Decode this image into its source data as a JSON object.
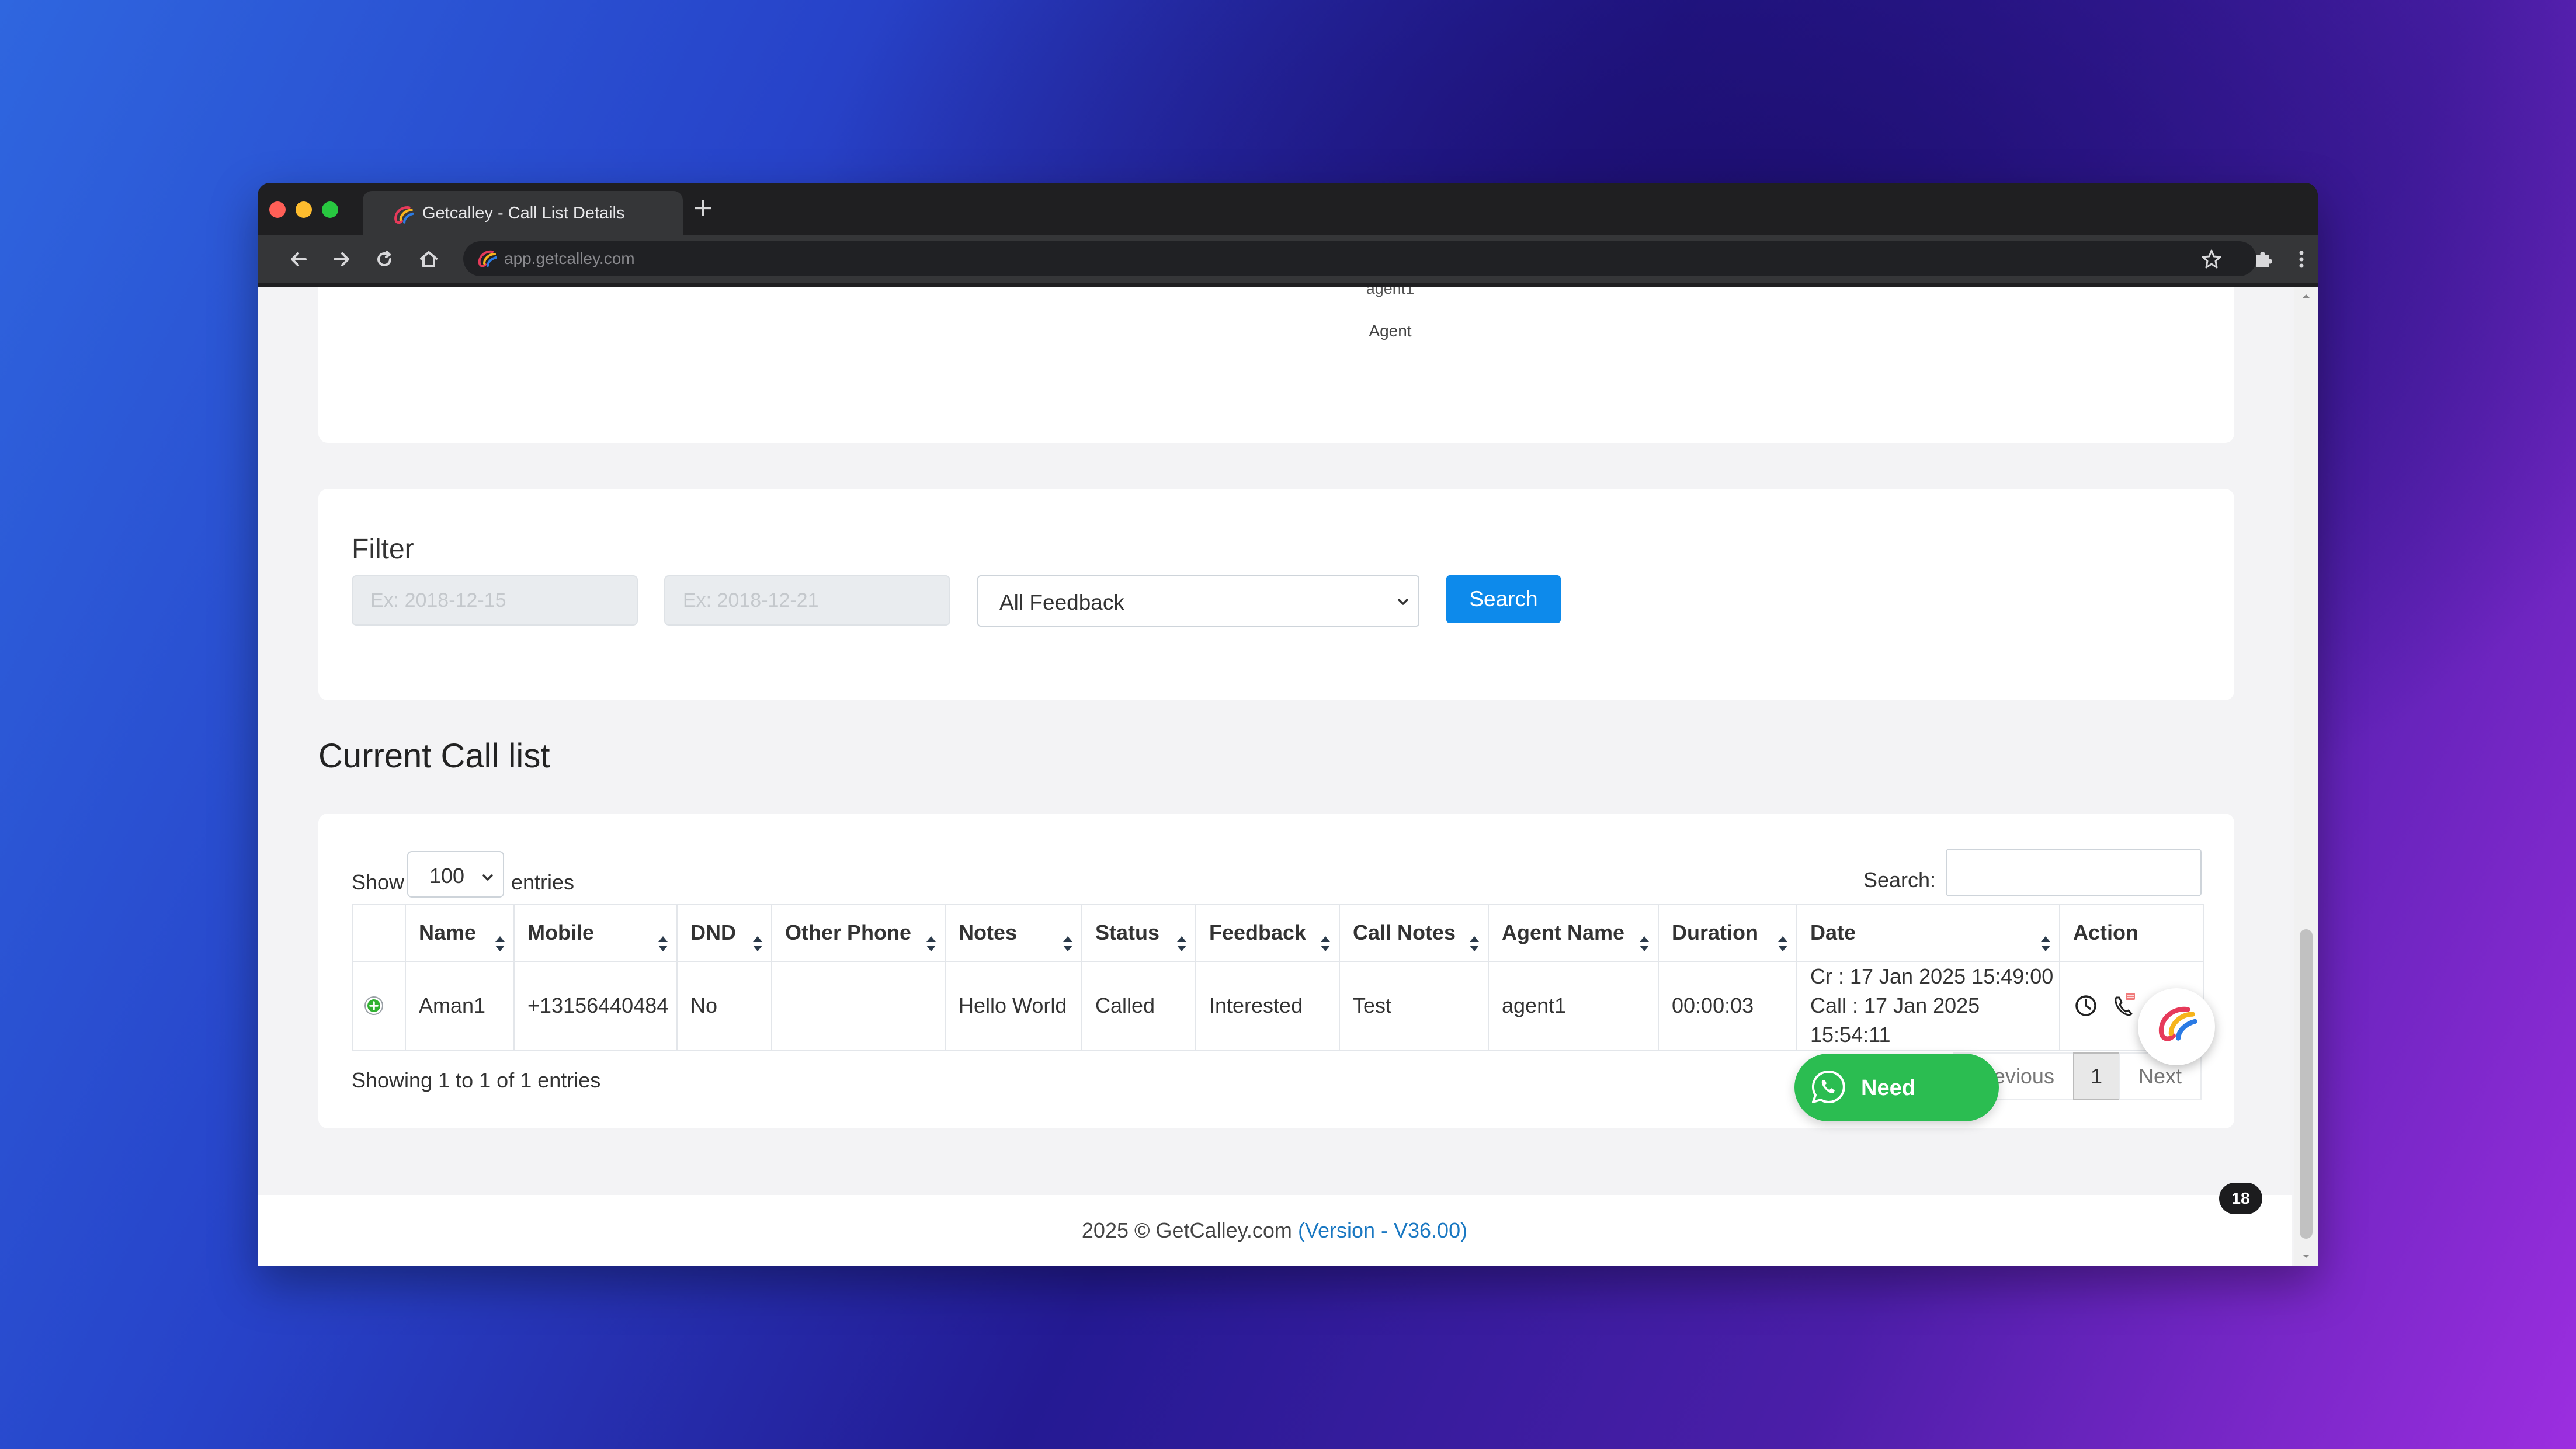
{
  "browser": {
    "tab_title": "Getcalley - Call List Details",
    "new_tab_symbol": "+",
    "url": "app.getcalley.com",
    "traffic_lights": [
      "#ff5f57",
      "#febc2e",
      "#28c840"
    ]
  },
  "profile": {
    "agent_username": "agent1",
    "agent_role": "Agent"
  },
  "filter": {
    "title": "Filter",
    "from_date_placeholder": "Ex: 2018-12-15",
    "to_date_placeholder": "Ex: 2018-12-21",
    "feedback_select": "All Feedback",
    "search_button": "Search"
  },
  "call_list": {
    "title": "Current Call list",
    "show_label": "Show",
    "entries_per_page": "100",
    "entries_label": "entries",
    "search_label": "Search:",
    "columns": [
      "",
      "Name",
      "Mobile",
      "DND",
      "Other Phone",
      "Notes",
      "Status",
      "Feedback",
      "Call Notes",
      "Agent Name",
      "Duration",
      "Date",
      "Action"
    ],
    "rows": [
      {
        "name": "Aman1",
        "mobile": "+13156440484",
        "dnd": "No",
        "other_phone": "",
        "notes": "Hello World",
        "status": "Called",
        "feedback": "Interested",
        "call_notes": "Test",
        "agent_name": "agent1",
        "duration": "00:00:03",
        "date_created": "Cr : 17 Jan 2025 15:49:00",
        "date_called": "Call : 17 Jan 2025 15:54:11",
        "actions": [
          "clock-icon",
          "phone-icon"
        ]
      }
    ],
    "info": "Showing 1 to 1 of 1 entries",
    "pagination": {
      "previous": "Previous",
      "current_page": "1",
      "next": "Next"
    }
  },
  "footer": {
    "copyright": "2025 © GetCalley.com ",
    "version": "(Version - V36.00)"
  },
  "widgets": {
    "whatsapp_label": "Need",
    "notification_count": "18"
  },
  "colors": {
    "primary": "#0d8aeb",
    "whatsapp": "#2bbd51",
    "link": "#1a78c2"
  }
}
